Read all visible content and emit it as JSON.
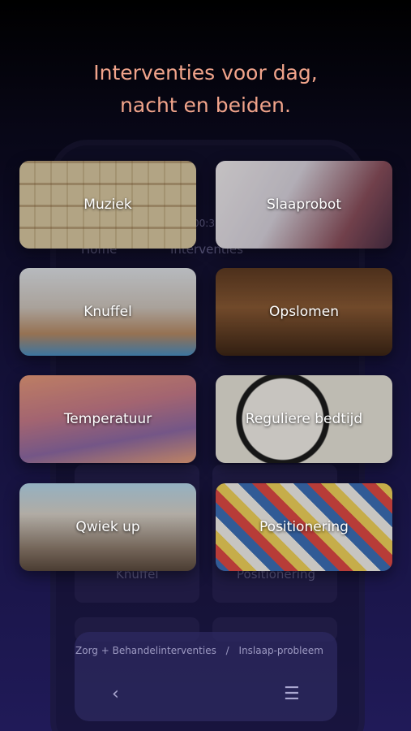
{
  "headline": {
    "line1": "Interventies voor dag,",
    "line2": "nacht en beiden."
  },
  "tiles": [
    {
      "label": "Muziek"
    },
    {
      "label": "Slaaprobot"
    },
    {
      "label": "Knuffel"
    },
    {
      "label": "Opslomen"
    },
    {
      "label": "Temperatuur"
    },
    {
      "label": "Reguliere bedtijd"
    },
    {
      "label": "Qwiek up"
    },
    {
      "label": "Positionering"
    }
  ],
  "ghost": {
    "time": "00:35",
    "back_label": "Home",
    "page_title": "Interventies",
    "knuffel": "Knuffel",
    "positionering": "Positionering"
  },
  "breadcrumb": {
    "item1": "Zorg + Behandelinterventies",
    "separator": "/",
    "item2": "Inslaap-probleem"
  },
  "nav": {
    "back_icon": "‹",
    "menu_icon": "☰"
  }
}
